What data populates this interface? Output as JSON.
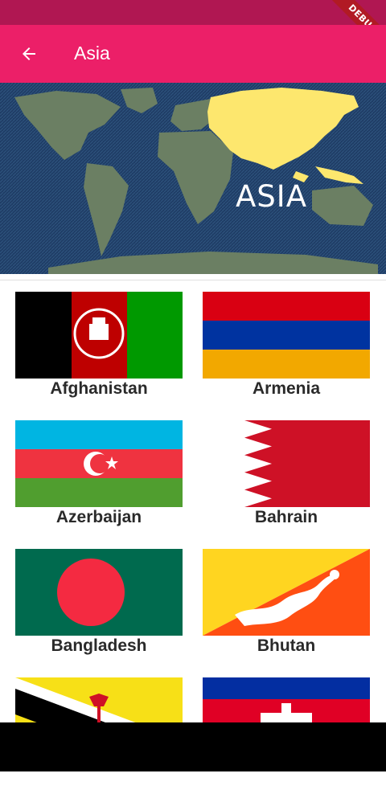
{
  "status_bar": {
    "debug_label": "DEBUG"
  },
  "app_bar": {
    "title": "Asia",
    "back_icon": "arrow-left-icon"
  },
  "banner": {
    "label": "ASIA",
    "highlight_color": "#fde76e",
    "ocean_color": "#1f3d66",
    "land_color": "#6b7f63"
  },
  "countries": [
    {
      "name": "Afghanistan"
    },
    {
      "name": "Armenia"
    },
    {
      "name": "Azerbaijan"
    },
    {
      "name": "Bahrain"
    },
    {
      "name": "Bangladesh"
    },
    {
      "name": "Bhutan"
    },
    {
      "name": ""
    },
    {
      "name": ""
    }
  ]
}
